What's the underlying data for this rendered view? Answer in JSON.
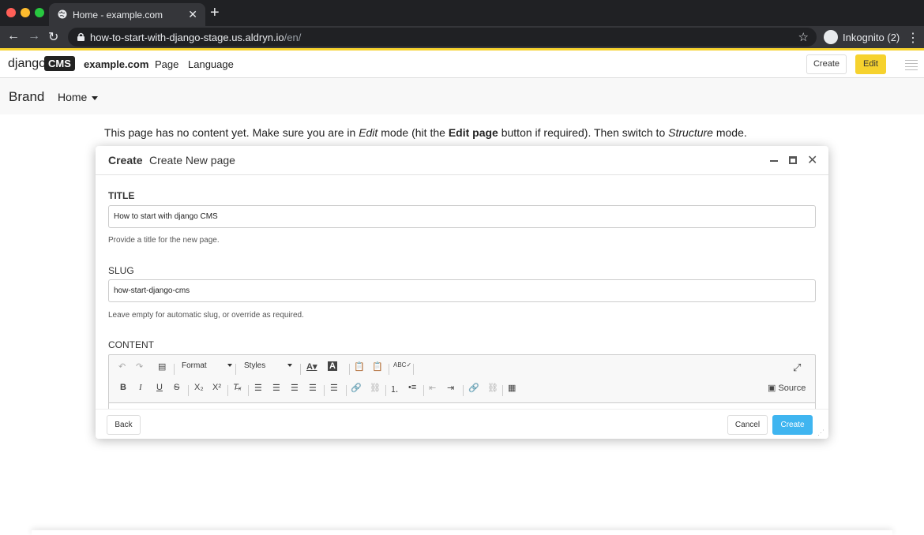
{
  "browser": {
    "tab_title": "Home - example.com",
    "tab_close": "✕",
    "new_tab": "+",
    "url_host": "how-to-start-with-django-stage.us.aldryn.io",
    "url_path": "/en/",
    "profile_label": "Inkognito (2)"
  },
  "cms_toolbar": {
    "logo_text": "django",
    "logo_box": "CMS",
    "site": "example.com",
    "menu": [
      "Page",
      "Language"
    ],
    "create_label": "Create",
    "edit_label": "Edit"
  },
  "site_nav": {
    "brand": "Brand",
    "home": "Home"
  },
  "notice": {
    "part1": "This page has no content yet. Make sure you are in ",
    "edit_word": "Edit",
    "part2": " mode (hit the ",
    "edit_page": "Edit page",
    "part3": " button if required). Then switch to ",
    "structure_word": "Structure",
    "part4": " mode."
  },
  "modal": {
    "header_bold": "Create",
    "header_title": "Create New page",
    "close_glyph": "✕",
    "title_label": "TITLE",
    "title_value": "How to start with django CMS",
    "title_help": "Provide a title for the new page.",
    "slug_label": "SLUG",
    "slug_value": "how-start-django-cms",
    "slug_help": "Leave empty for automatic slug, or override as required.",
    "content_label": "CONTENT",
    "format_label": "Format",
    "styles_label": "Styles",
    "source_label": "Source",
    "back_label": "Back",
    "cancel_label": "Cancel",
    "create_label": "Create"
  },
  "colors": {
    "accent_yellow": "#f6d22e",
    "create_blue": "#3fb5f0"
  }
}
